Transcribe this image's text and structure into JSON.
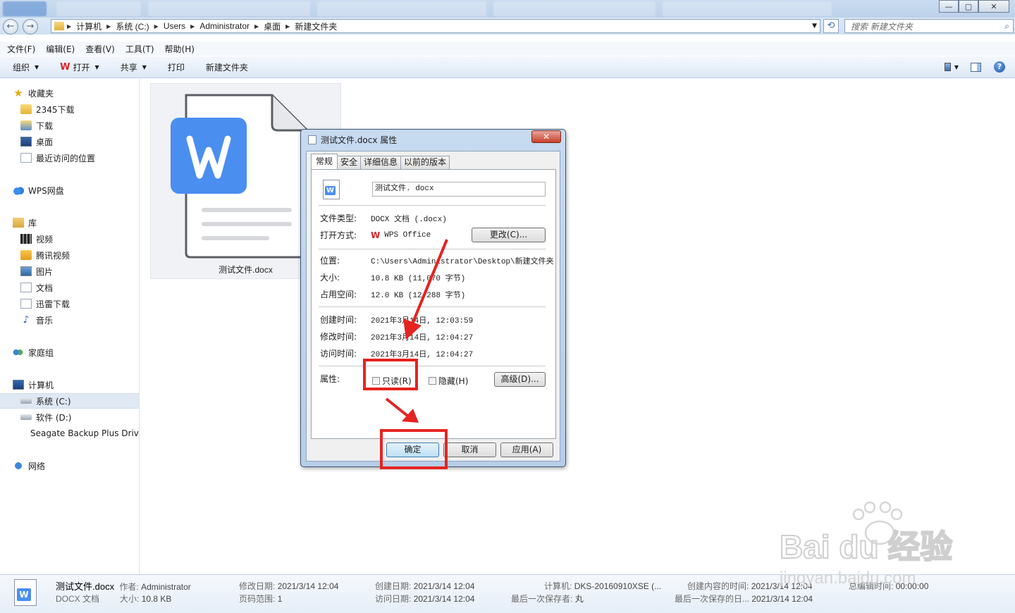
{
  "window": {
    "close_glyph": "✕",
    "max_glyph": "▢",
    "min_glyph": "—"
  },
  "address": {
    "crumbs": [
      "计算机",
      "系统 (C:)",
      "Users",
      "Administrator",
      "桌面",
      "新建文件夹"
    ],
    "search_placeholder": "搜索 新建文件夹"
  },
  "menubar": [
    "文件(F)",
    "编辑(E)",
    "查看(V)",
    "工具(T)",
    "帮助(H)"
  ],
  "toolbar": {
    "organize": "组织",
    "open": "打开",
    "share": "共享",
    "print": "打印",
    "new_folder": "新建文件夹"
  },
  "nav": {
    "favorites": "收藏夹",
    "fav_items": [
      "2345下载",
      "下载",
      "桌面",
      "最近访问的位置"
    ],
    "wps_cloud": "WPS网盘",
    "libraries": "库",
    "lib_items": [
      "视频",
      "腾讯视频",
      "图片",
      "文档",
      "迅雷下载",
      "音乐"
    ],
    "homegroup": "家庭组",
    "computer": "计算机",
    "drives": [
      "系统 (C:)",
      "软件 (D:)",
      "Seagate Backup Plus Drive"
    ],
    "network": "网络"
  },
  "file": {
    "name": "测试文件.docx"
  },
  "dialog": {
    "title": "测试文件.docx 属性",
    "tabs": [
      "常规",
      "安全",
      "详细信息",
      "以前的版本"
    ],
    "filename": "测试文件. docx",
    "type_label": "文件类型:",
    "type_value": "DOCX 文档 (.docx)",
    "open_with_label": "打开方式:",
    "open_with_value": "WPS Office",
    "change_button": "更改(C)...",
    "location_label": "位置:",
    "location_value": "C:\\Users\\Administrator\\Desktop\\新建文件夹",
    "size_label": "大小:",
    "size_value": "10.8 KB (11,070 字节)",
    "disk_label": "占用空间:",
    "disk_value": "12.0 KB (12,288 字节)",
    "created_label": "创建时间:",
    "created_value": "2021年3月14日, 12:03:59",
    "modified_label": "修改时间:",
    "modified_value": "2021年3月14日, 12:04:27",
    "accessed_label": "访问时间:",
    "accessed_value": "2021年3月14日, 12:04:27",
    "attributes_label": "属性:",
    "readonly_label": "只读(R)",
    "hidden_label": "隐藏(H)",
    "advanced_button": "高级(D)...",
    "ok_button": "确定",
    "cancel_button": "取消",
    "apply_button": "应用(A)"
  },
  "details": {
    "name": "测试文件.docx",
    "type": "DOCX 文档",
    "author_key": "作者:",
    "author": "Administrator",
    "size_key": "大小:",
    "size": "10.8 KB",
    "modified_key": "修改日期:",
    "modified": "2021/3/14 12:04",
    "pages_key": "页码范围:",
    "pages": "1",
    "created_key": "创建日期:",
    "created": "2021/3/14 12:04",
    "accessed_key": "访问日期:",
    "accessed": "2021/3/14 12:04",
    "computer_key": "计算机:",
    "computer": "DKS-20160910XSE (...",
    "saved_by_key": "最后一次保存者:",
    "saved_by": "丸",
    "content_created_key": "创建内容的时间:",
    "content_created": "2021/3/14 12:04",
    "last_saved_key": "最后一次保存的日...",
    "last_saved": "2021/3/14 12:04",
    "edit_time_key": "总编辑时间:",
    "edit_time": "00:00:00"
  },
  "watermark": {
    "brand": "Bai du 经验",
    "url": "jingyan.baidu.com"
  },
  "colors": {
    "annotation_red": "#e52421",
    "wps_blue": "#4a8ef0",
    "wps_red": "#d6232a"
  }
}
